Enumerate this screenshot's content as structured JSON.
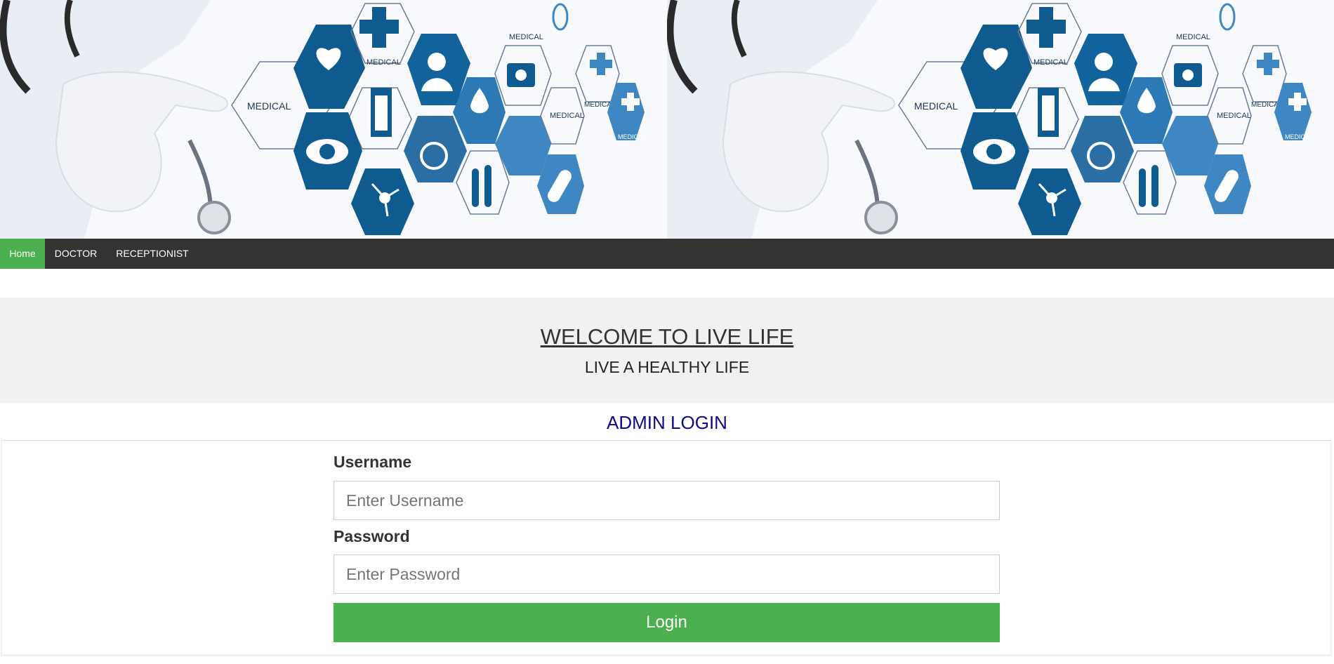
{
  "banner": {
    "panels": 2,
    "hex_labels": [
      "MEDICAL",
      "MEDICAL",
      "MEDICAL",
      "MEDICAL",
      "MEDICAL",
      "MEDICAL"
    ],
    "icons": [
      "stethoscope-icon",
      "heart-icon",
      "cross-icon",
      "doctor-icon",
      "clipboard-icon",
      "eye-icon",
      "molecule-icon",
      "wheelchair-icon",
      "blood-drops-icon",
      "test-tubes-icon",
      "syringe-icon",
      "pill-icon",
      "medical-kit-icon",
      "microscope-icon"
    ]
  },
  "nav": {
    "items": [
      {
        "label": "Home",
        "active": true
      },
      {
        "label": "DOCTOR",
        "active": false
      },
      {
        "label": "RECEPTIONIST",
        "active": false
      }
    ],
    "accent_color": "#4caf50",
    "bar_color": "#333333"
  },
  "hero": {
    "title": "WELCOME TO LIVE LIFE",
    "subtitle": "LIVE A HEALTHY LIFE",
    "background": "#f1f1f1"
  },
  "login": {
    "title": "ADMIN LOGIN",
    "title_color": "#0b0b8a",
    "username_label": "Username",
    "username_placeholder": "Enter Username",
    "username_value": "",
    "password_label": "Password",
    "password_placeholder": "Enter Password",
    "password_value": "",
    "button_label": "Login",
    "button_color": "#4caf50"
  }
}
